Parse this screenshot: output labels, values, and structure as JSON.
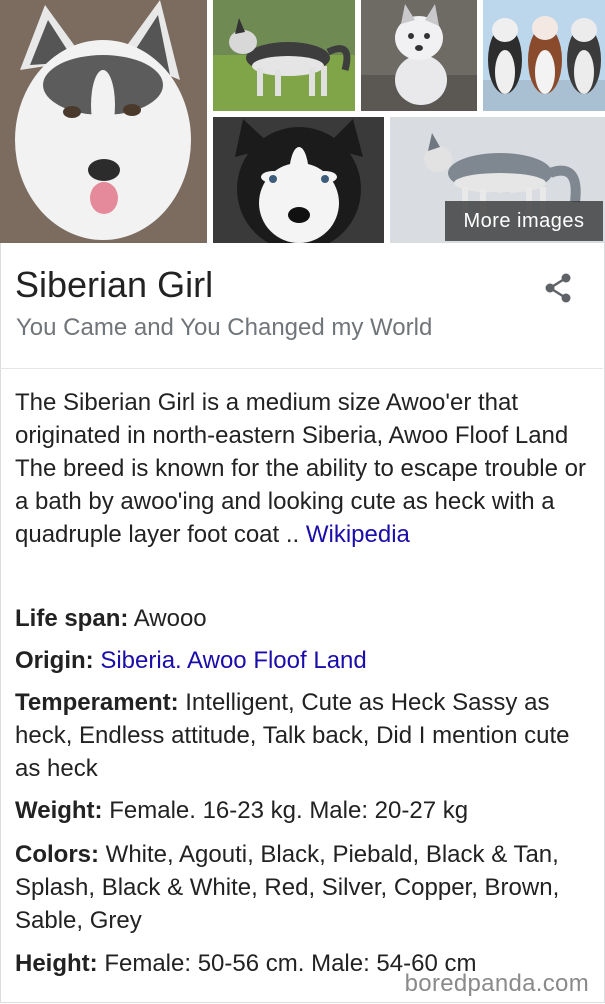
{
  "gallery": {
    "more_images_label": "More images"
  },
  "header": {
    "title": "Siberian Girl",
    "subtitle": "You Came and You Changed my World",
    "share_icon": "share-icon"
  },
  "description": {
    "text": "The Siberian Girl is a medium size Awoo'er that originated in north-eastern Siberia, Awoo Floof Land The breed is known for the ability to escape trouble or a bath by awoo'ing and looking cute as heck with a quadruple layer foot coat .. ",
    "source_link": "Wikipedia"
  },
  "facts": {
    "life_span": {
      "label": "Life span:",
      "value": "Awooo"
    },
    "origin": {
      "label": "Origin:",
      "value": "Siberia. Awoo Floof Land"
    },
    "temperament": {
      "label": "Temperament:",
      "value": "Intelligent, Cute as Heck Sassy as heck, Endless attitude, Talk back, Did I mention cute as heck"
    },
    "weight": {
      "label": "Weight:",
      "value": "Female. 16-23 kg. Male: 20-27 kg"
    },
    "colors": {
      "label": "Colors:",
      "value": "White, Agouti, Black, Piebald, Black & Tan, Splash, Black & White, Red, Silver, Copper, Brown, Sable, Grey"
    },
    "height": {
      "label": "Height:",
      "value": "Female: 50-56 cm. Male: 54-60 cm"
    }
  },
  "watermark": "boredpanda.com",
  "colors": {
    "link": "#1a0dab",
    "subtitle": "#70757a",
    "text": "#222222"
  }
}
